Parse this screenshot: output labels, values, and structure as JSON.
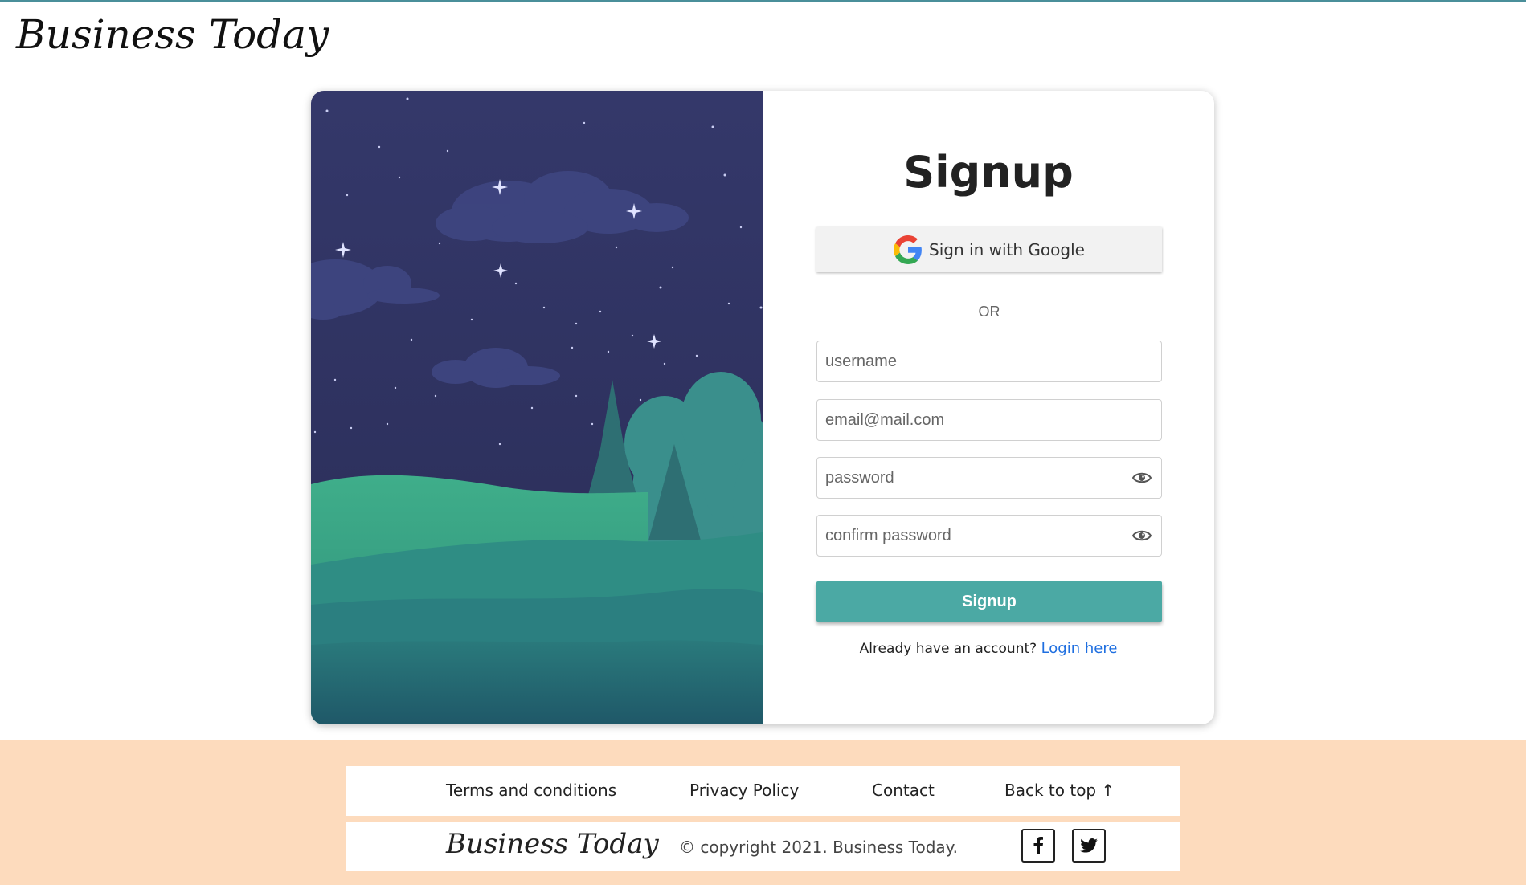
{
  "header": {
    "brand": "Business Today"
  },
  "signup_form": {
    "title": "Signup",
    "google_button": "Sign in with Google",
    "divider": "OR",
    "username_placeholder": "username",
    "email_placeholder": "email@mail.com",
    "password_placeholder": "password",
    "confirm_password_placeholder": "confirm password",
    "submit_label": "Signup",
    "login_prompt": "Already have an account?",
    "login_link": "Login here"
  },
  "footer": {
    "links": {
      "terms": "Terms and conditions",
      "privacy": "Privacy Policy",
      "contact": "Contact",
      "back_to_top": "Back to top ↑"
    },
    "brand": "Business Today",
    "copyright": "© copyright 2021. Business Today.",
    "social_icons": [
      "facebook-icon",
      "twitter-icon"
    ]
  },
  "colors": {
    "accent": "#4ba9a4",
    "footer_bg": "#fddbbd",
    "link": "#1f6fe0",
    "night_sky": "#2b3160"
  }
}
